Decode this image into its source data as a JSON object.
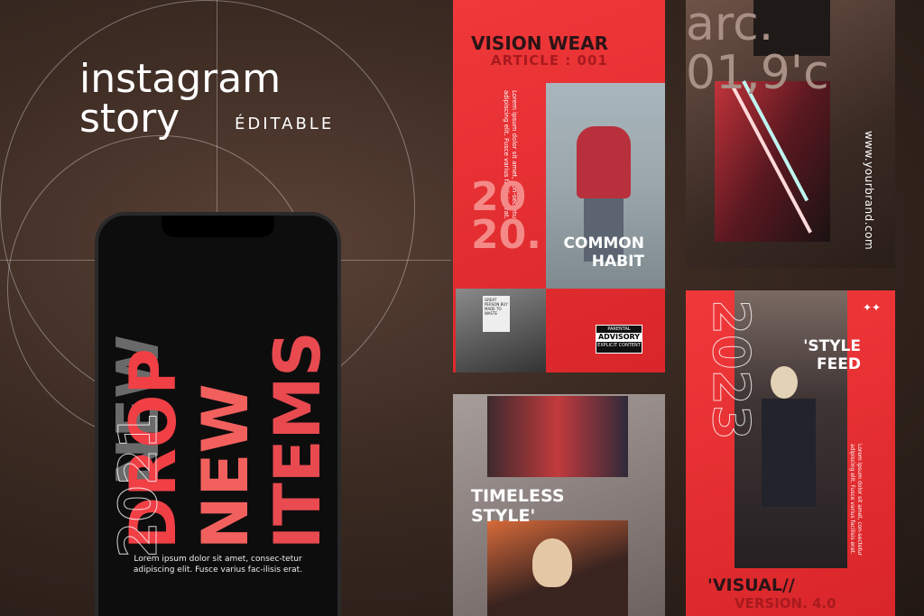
{
  "header": {
    "line1": "instagram",
    "line2": "story",
    "badge": "ÉDITABLE"
  },
  "phone": {
    "outline_word": "NEW",
    "headline": [
      "DROP",
      "NEW",
      "ITEMS"
    ],
    "year": "2021",
    "body": "Lorem ipsum dolor sit amet, consec-tetur adipiscing elit. Fusce varius fac-ilisis erat."
  },
  "cards": {
    "vision": {
      "title": "VISION WEAR",
      "subtitle": "ARTICLE : 001",
      "side_text": "Lorem ipsum dolor sit amet, con-sectetur adipiscing elit. Fusce varius facilisis erat.",
      "year": "20 20.",
      "headline1": "COMMON",
      "headline2": "HABIT",
      "advisory_top": "PARENTAL",
      "advisory_mid": "ADVISORY",
      "advisory_bot": "EXPLICIT CONTENT",
      "bag_text": "GREAT PERSON BUY MADE TO WASTE"
    },
    "brand": {
      "outline1": "arc.",
      "outline2": "01,9'c",
      "url": "www.yourbrand.com"
    },
    "timeless": {
      "headline1": "TIMELESS",
      "headline2": "STYLE'"
    },
    "visual": {
      "headline1": "'STYLE",
      "headline2": "FEED",
      "side_text": "Lorem ipsum dolor sit amet, con-sectetur adipiscing elit. Fusce varius facilisis erat.",
      "year": "2023",
      "title": "'VISUAL//",
      "subtitle": "VERSION. 4.0",
      "sparkle": "✦✦"
    }
  },
  "colors": {
    "accent": "#e8302f",
    "background": "#3a2a22"
  }
}
